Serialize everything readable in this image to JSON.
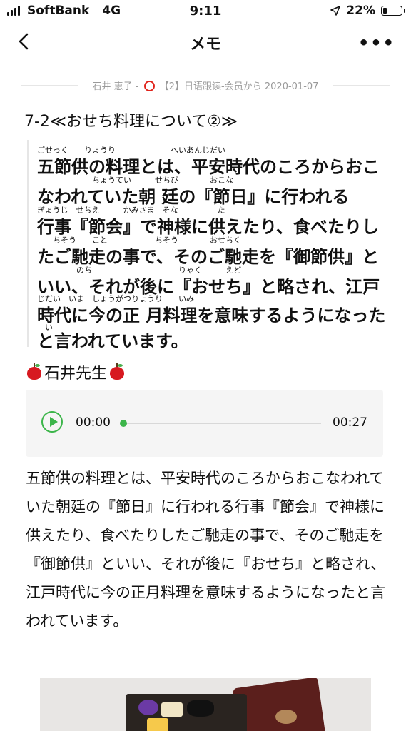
{
  "status": {
    "carrier": "SoftBank",
    "network": "4G",
    "time": "9:11",
    "battery_percent": "22%",
    "battery_level": 0.22
  },
  "nav": {
    "title": "メモ",
    "back_icon": "chevron-left-icon",
    "more_icon": "ellipsis-icon"
  },
  "meta": {
    "author": "石井 恵子 -",
    "source": "【2】日语跟读-会员から",
    "date": "2020-01-07"
  },
  "heading": "7-2≪おせち料理について②≫",
  "furigana_block": {
    "lines": [
      "五節供の料理とは、平安時代のころからおこ",
      "なわれていた朝 廷の『節日』に行われる",
      "行事『節会』で神様に供えたり、食べたりし",
      "たご馳走の事で、そのご馳走を『御節供』と",
      "いい、それが後に『おせち』と略され、江戸",
      "時代に今の正 月料理を意味するようになった",
      "と言われています。"
    ],
    "ruby": [
      "ごせっく　　りょうり　　　　　　　へいあんじだい",
      "　　　　　　　ちょうてい　　　せちび　　　　おこな",
      "ぎょうじ　せちえ　　　かみさま　そな　　　　　た",
      "　　ちそう　　こと　　　　　　ちそう　　　　おせちく",
      "　　　　　のち　　　　　　　　　　　りゃく　　　えど",
      "じだい　いま　しょうがつりょうり　　いみ",
      "　い"
    ]
  },
  "teacher": {
    "name": "石井先生",
    "icon": "red-apple-icon"
  },
  "audio": {
    "current_time": "00:00",
    "duration": "00:27",
    "progress": 0.0,
    "play_icon": "play-icon",
    "accent_color": "#3cb54a"
  },
  "body_text": "五節供の料理とは、平安時代のころからおこなわれていた朝廷の『節日』に行われる行事『節会』で神様に供えたり、食べたりしたご馳走の事で、そのご馳走を『御節供』といい、それが後に『おせち』と略され、江戸時代に今の正月料理を意味するようになったと言われています。"
}
